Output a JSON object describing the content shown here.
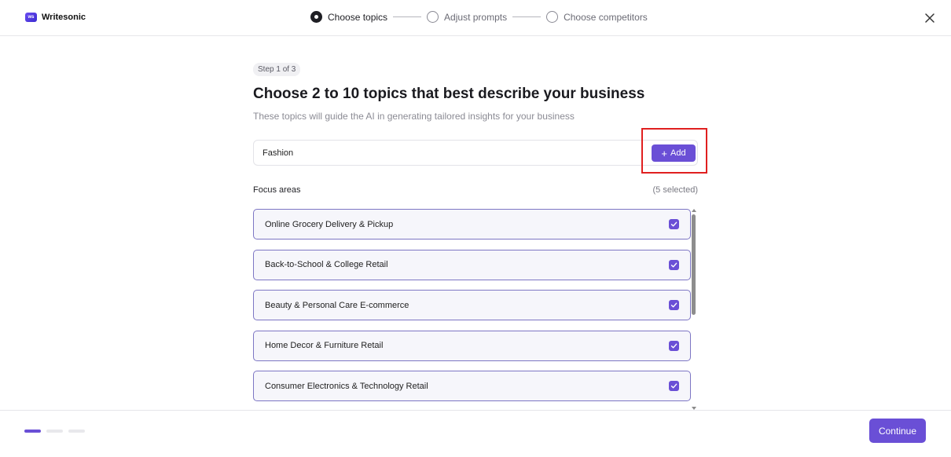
{
  "app": {
    "logo_text": "Writesonic",
    "logo_badge": "ws"
  },
  "stepper": {
    "steps": [
      {
        "label": "Choose topics",
        "active": true
      },
      {
        "label": "Adjust prompts",
        "active": false
      },
      {
        "label": "Choose competitors",
        "active": false
      }
    ]
  },
  "main": {
    "step_badge": "Step 1 of 3",
    "title": "Choose 2 to 10 topics that best describe your business",
    "subtitle": "These topics will guide the AI in generating tailored insights for your business",
    "input": {
      "value": "Fashion",
      "placeholder": ""
    },
    "add_button": {
      "icon": "+",
      "label": "Add"
    },
    "focus_areas": {
      "label": "Focus areas",
      "count_text": "(5 selected)",
      "items": [
        {
          "label": "Online Grocery Delivery & Pickup",
          "checked": true
        },
        {
          "label": "Back-to-School & College Retail",
          "checked": true
        },
        {
          "label": "Beauty & Personal Care E-commerce",
          "checked": true
        },
        {
          "label": "Home Decor & Furniture Retail",
          "checked": true
        },
        {
          "label": "Consumer Electronics & Technology Retail",
          "checked": true
        }
      ]
    }
  },
  "footer": {
    "progress_segments": 3,
    "progress_active": 1,
    "continue_label": "Continue"
  },
  "colors": {
    "accent": "#6a4fd6",
    "highlight_border": "#e02020",
    "item_border": "#7d76c4"
  }
}
